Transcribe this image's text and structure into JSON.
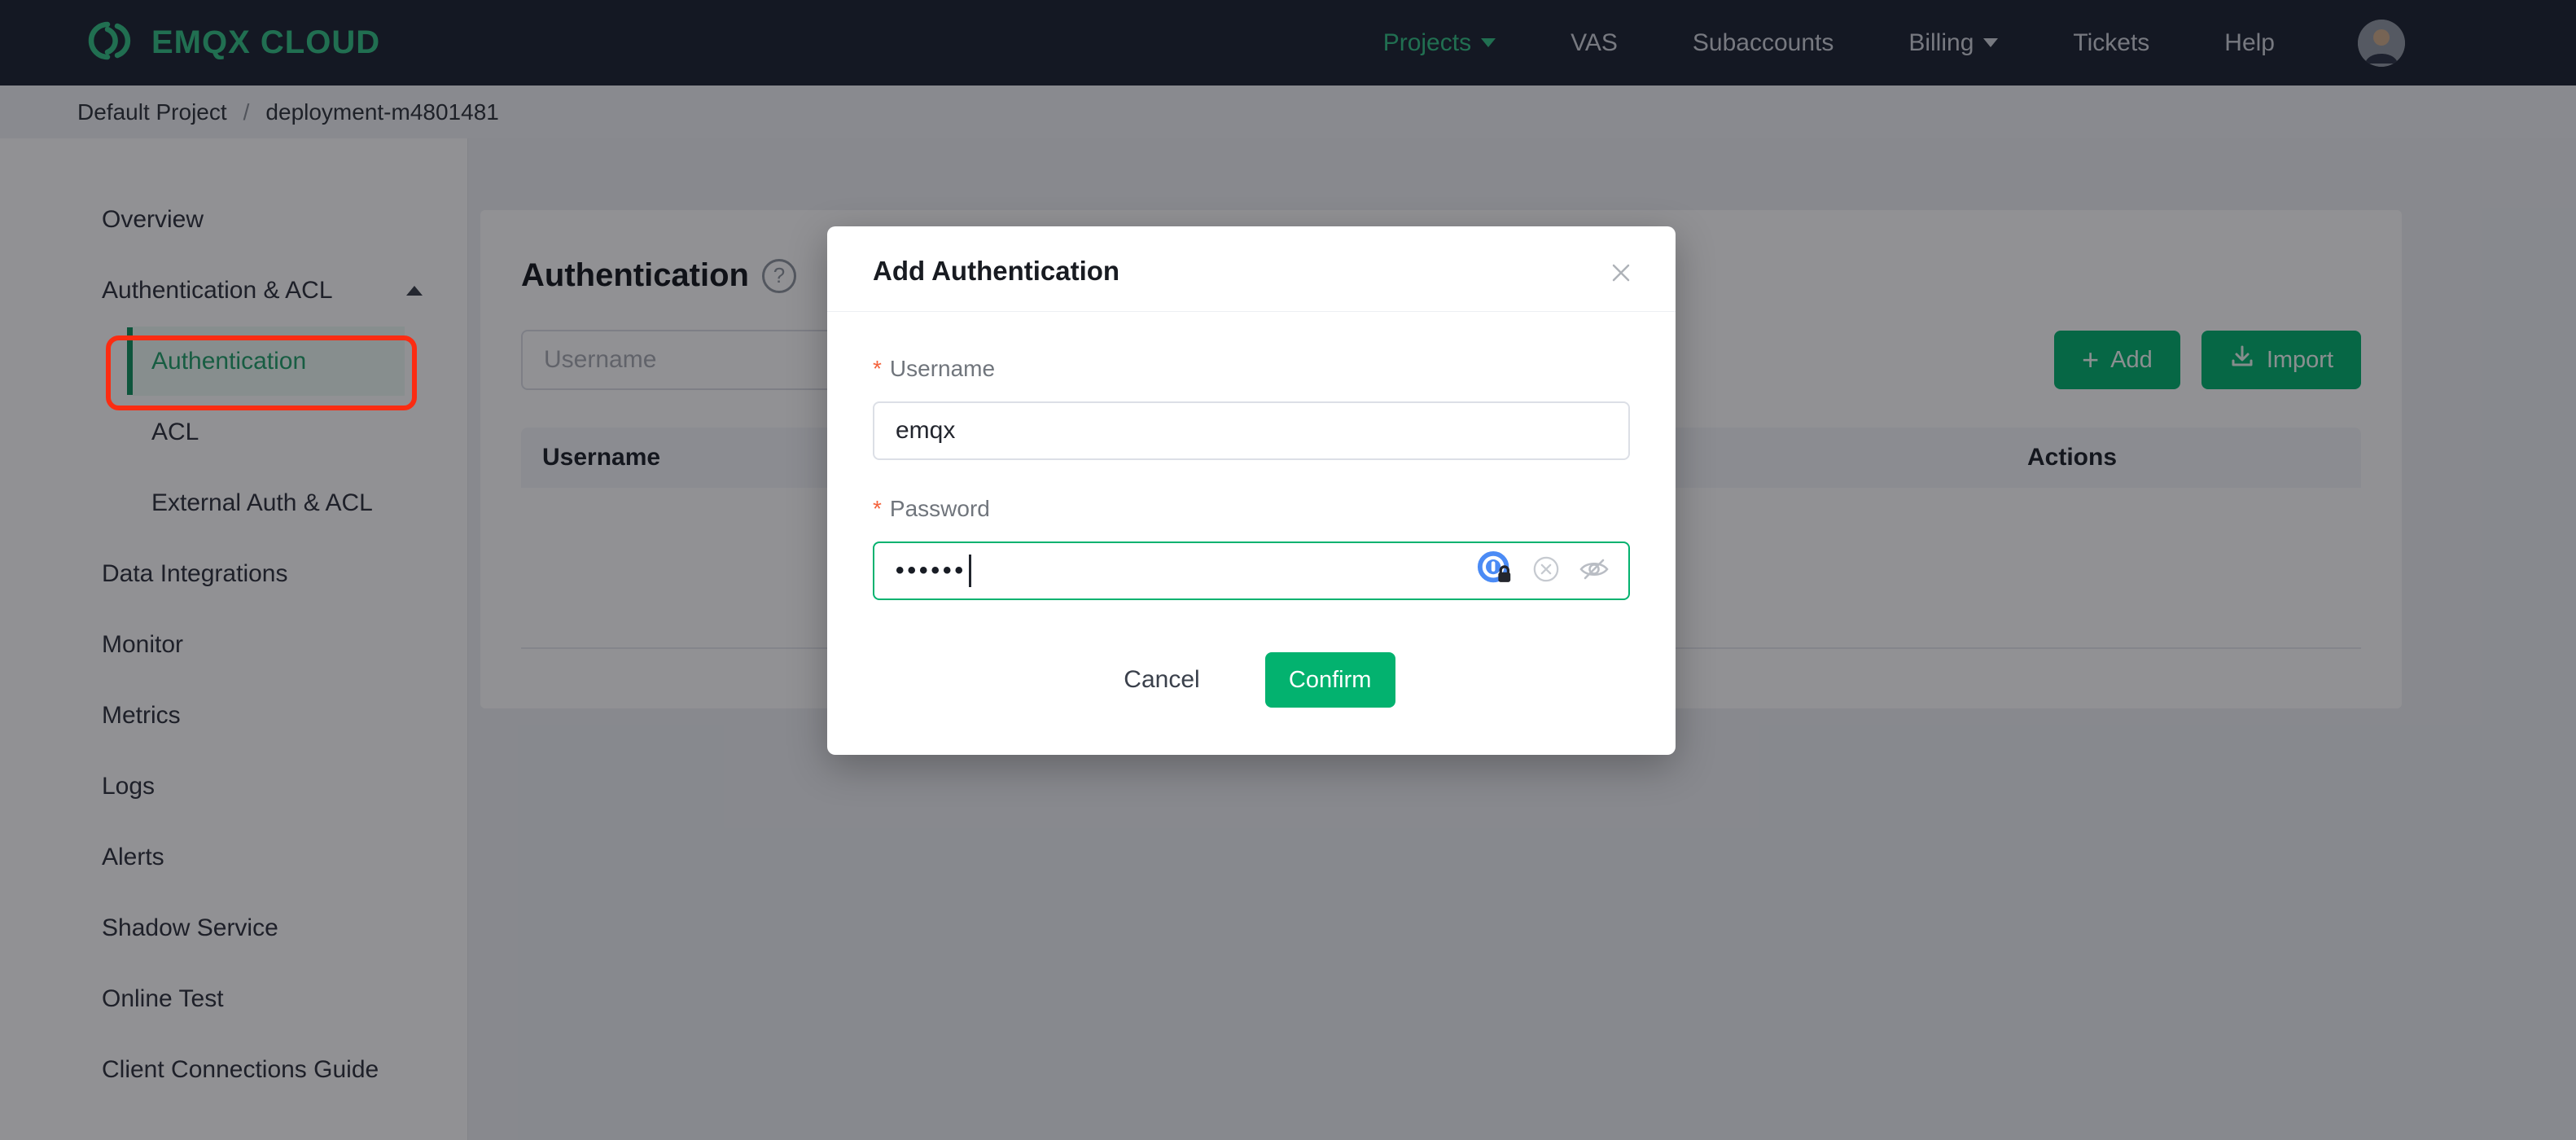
{
  "navbar": {
    "brand": "EMQX CLOUD",
    "items": [
      {
        "label": "Projects",
        "has_caret": true,
        "active": true
      },
      {
        "label": "VAS"
      },
      {
        "label": "Subaccounts"
      },
      {
        "label": "Billing",
        "has_caret": true
      },
      {
        "label": "Tickets"
      },
      {
        "label": "Help"
      }
    ]
  },
  "breadcrumb": {
    "project": "Default Project",
    "separator": "/",
    "deployment": "deployment-m4801481"
  },
  "sidebar": {
    "items": [
      {
        "label": "Overview"
      },
      {
        "label": "Authentication & ACL",
        "expanded": true,
        "children": [
          {
            "label": "Authentication",
            "active": true,
            "annotated": true
          },
          {
            "label": "ACL"
          },
          {
            "label": "External Auth & ACL"
          }
        ]
      },
      {
        "label": "Data Integrations"
      },
      {
        "label": "Monitor"
      },
      {
        "label": "Metrics"
      },
      {
        "label": "Logs"
      },
      {
        "label": "Alerts"
      },
      {
        "label": "Shadow Service"
      },
      {
        "label": "Online Test"
      },
      {
        "label": "Client Connections Guide"
      }
    ]
  },
  "main": {
    "title": "Authentication",
    "help_icon": "?",
    "filter": {
      "placeholder": "Username"
    },
    "add_button": {
      "icon": "+",
      "label": "Add"
    },
    "import_button": {
      "label": "Import"
    },
    "table": {
      "columns": [
        "Username",
        "Actions"
      ]
    }
  },
  "modal": {
    "title": "Add Authentication",
    "required_marker": "*",
    "username": {
      "label": "Username",
      "value": "emqx"
    },
    "password": {
      "label": "Password",
      "masked_value": "••••••"
    },
    "cancel_label": "Cancel",
    "confirm_label": "Confirm"
  },
  "colors": {
    "accent": "#03b26f",
    "brand_green": "#33c186",
    "annotation_red": "#fb2c12",
    "nav_bg": "#1d2432",
    "overlay": "rgba(10,12,18,0.45)"
  }
}
